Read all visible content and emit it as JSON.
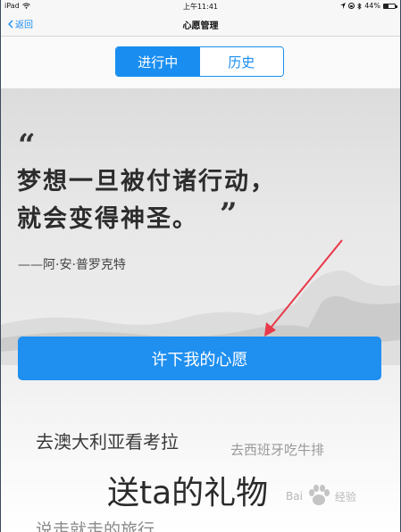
{
  "status_bar": {
    "device": "iPad",
    "time": "上午11:41",
    "battery": "44%",
    "battery_level": 0.44
  },
  "nav": {
    "back_label": "返回",
    "title": "心愿管理"
  },
  "segments": {
    "active": "进行中",
    "inactive": "历史"
  },
  "hero": {
    "quote_line1": "梦想一旦被付诸行动，",
    "quote_line2": "就会变得神圣。",
    "open_quote": "“",
    "close_quote": "”",
    "author": "——阿·安·普罗克特"
  },
  "wish_button": "许下我的心愿",
  "tags": {
    "tag1": "去澳大利亚看考拉",
    "tag2": "去西班牙吃牛排",
    "tag3": "送ta的礼物",
    "tag4": "说走就走的旅行"
  },
  "watermark": {
    "text": "经验",
    "brand": "Bai"
  },
  "colors": {
    "accent": "#1a8ef0",
    "button": "#1f8ff0",
    "annotation_arrow": "#e83a4a"
  }
}
